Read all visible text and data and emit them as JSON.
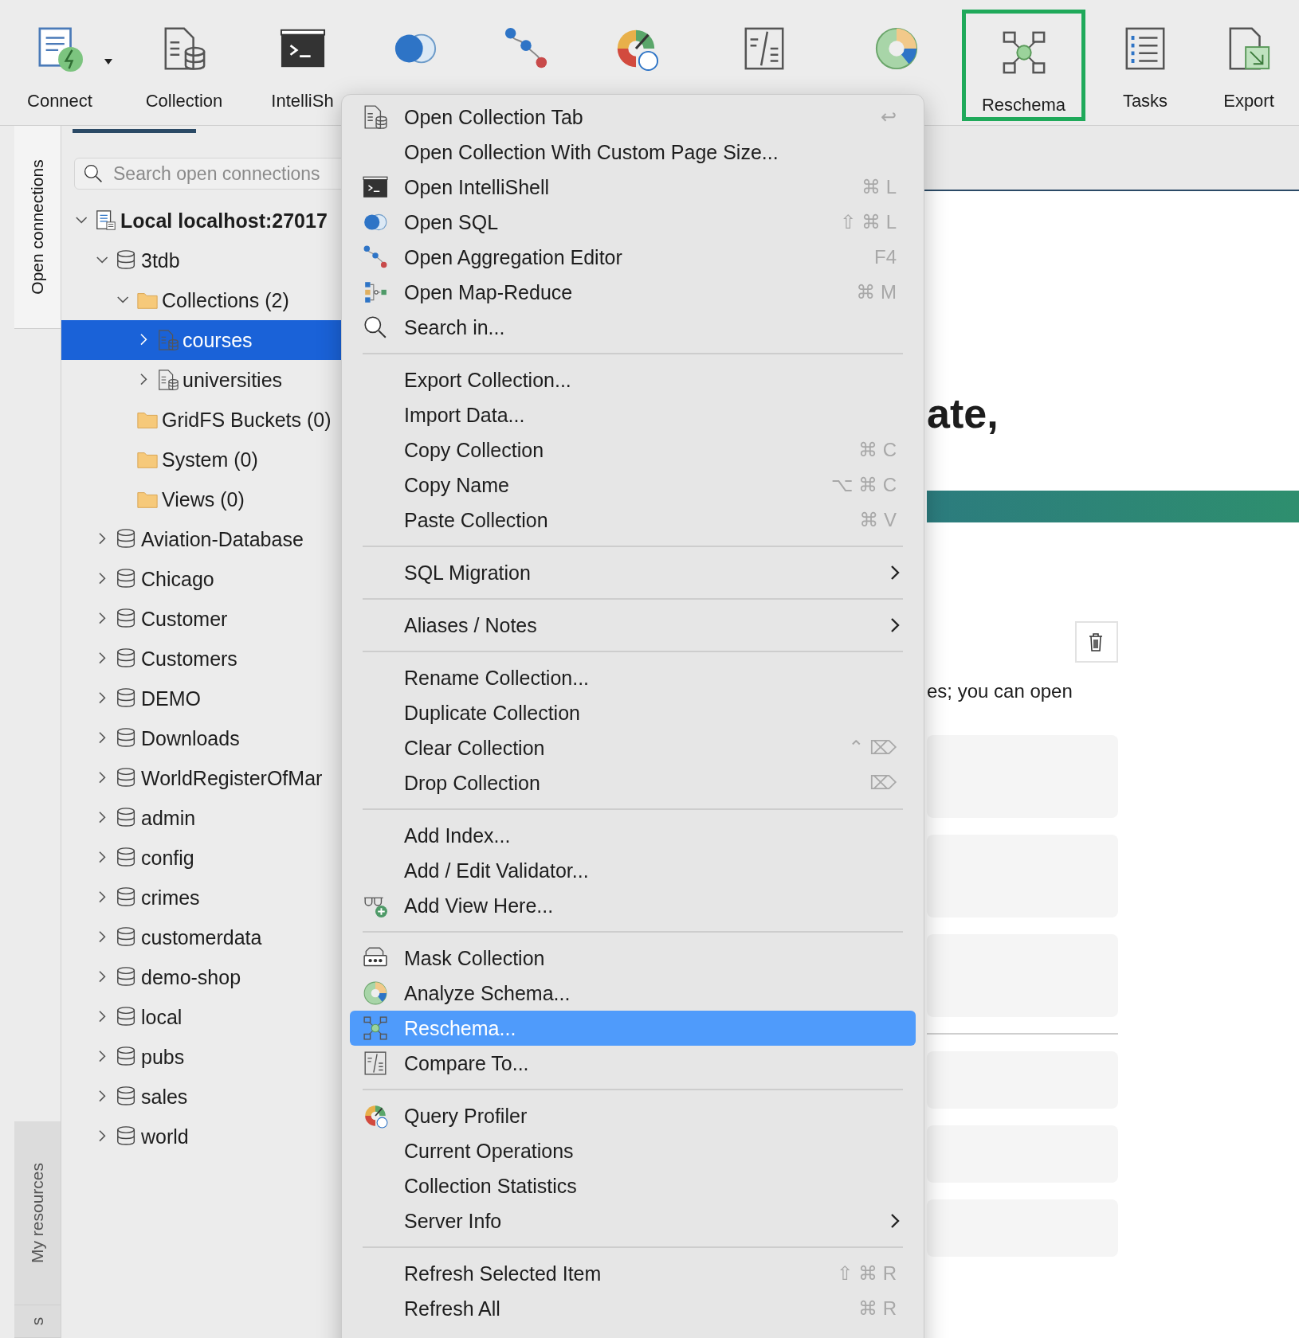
{
  "toolbar": [
    {
      "label": "Connect",
      "dropdown": true,
      "highlighted": false
    },
    {
      "label": "Collection",
      "highlighted": false
    },
    {
      "label": "IntelliSh",
      "highlighted": false
    },
    {
      "highlighted": false
    },
    {
      "highlighted": false
    },
    {
      "highlighted": false
    },
    {
      "highlighted": false
    },
    {
      "highlighted": false
    },
    {
      "label": "Reschema",
      "highlighted": true
    },
    {
      "label": "Tasks",
      "highlighted": false
    },
    {
      "label": "Export",
      "highlighted": false
    }
  ],
  "side_tabs": [
    {
      "label": "Open connections",
      "selected": true
    },
    {
      "label": "My resources",
      "selected": false
    },
    {
      "label": "s",
      "selected": false
    }
  ],
  "search": {
    "placeholder": "Search open connections"
  },
  "tree": [
    {
      "kind": "server",
      "label": "Local localhost:27017",
      "expanded": true,
      "selected": false,
      "children": [
        {
          "kind": "db",
          "label": "3tdb",
          "expanded": true,
          "selected": false,
          "children": [
            {
              "kind": "folder",
              "label": "Collections (2)",
              "expanded": true,
              "selected": false,
              "children": [
                {
                  "kind": "collection",
                  "label": "courses",
                  "expanded": false,
                  "selected": true
                },
                {
                  "kind": "collection",
                  "label": "universities",
                  "expanded": false,
                  "selected": false
                }
              ]
            },
            {
              "kind": "folder",
              "label": "GridFS Buckets (0)",
              "selected": false
            },
            {
              "kind": "folder",
              "label": "System (0)",
              "selected": false
            },
            {
              "kind": "folder",
              "label": "Views (0)",
              "selected": false
            }
          ]
        },
        {
          "kind": "db",
          "label": "Aviation-Database",
          "expanded": false,
          "selected": false
        },
        {
          "kind": "db",
          "label": "Chicago",
          "expanded": false,
          "selected": false
        },
        {
          "kind": "db",
          "label": "Customer",
          "expanded": false,
          "selected": false
        },
        {
          "kind": "db",
          "label": "Customers",
          "expanded": false,
          "selected": false
        },
        {
          "kind": "db",
          "label": "DEMO",
          "expanded": false,
          "selected": false
        },
        {
          "kind": "db",
          "label": "Downloads",
          "expanded": false,
          "selected": false
        },
        {
          "kind": "db",
          "label": "WorldRegisterOfMar",
          "expanded": false,
          "selected": false
        },
        {
          "kind": "db",
          "label": "admin",
          "expanded": false,
          "selected": false
        },
        {
          "kind": "db",
          "label": "config",
          "expanded": false,
          "selected": false
        },
        {
          "kind": "db",
          "label": "crimes",
          "expanded": false,
          "selected": false
        },
        {
          "kind": "db",
          "label": "customerdata",
          "expanded": false,
          "selected": false
        },
        {
          "kind": "db",
          "label": "demo-shop",
          "expanded": false,
          "selected": false
        },
        {
          "kind": "db",
          "label": "local",
          "expanded": false,
          "selected": false
        },
        {
          "kind": "db",
          "label": "pubs",
          "expanded": false,
          "selected": false
        },
        {
          "kind": "db",
          "label": "sales",
          "expanded": false,
          "selected": false
        },
        {
          "kind": "db",
          "label": "world",
          "expanded": false,
          "selected": false
        }
      ]
    }
  ],
  "main": {
    "heading": "ate,",
    "text": "es; you can open"
  },
  "context_menu": [
    {
      "kind": "item",
      "label": "Open Collection Tab",
      "shortcut": "↩",
      "submenu": false,
      "selected": false
    },
    {
      "kind": "item",
      "label": "Open Collection With Custom Page Size...",
      "submenu": false,
      "selected": false
    },
    {
      "kind": "item",
      "label": "Open IntelliShell",
      "shortcut": "⌘ L",
      "submenu": false,
      "selected": false
    },
    {
      "kind": "item",
      "label": "Open SQL",
      "shortcut": "⇧ ⌘ L",
      "submenu": false,
      "selected": false
    },
    {
      "kind": "item",
      "label": "Open Aggregation Editor",
      "shortcut": "F4",
      "submenu": false,
      "selected": false
    },
    {
      "kind": "item",
      "label": "Open Map-Reduce",
      "shortcut": "⌘ M",
      "submenu": false,
      "selected": false
    },
    {
      "kind": "item",
      "label": "Search in...",
      "submenu": false,
      "selected": false
    },
    {
      "kind": "separator"
    },
    {
      "kind": "item",
      "label": "Export Collection...",
      "submenu": false,
      "selected": false
    },
    {
      "kind": "item",
      "label": "Import Data...",
      "submenu": false,
      "selected": false
    },
    {
      "kind": "item",
      "label": "Copy Collection",
      "shortcut": "⌘ C",
      "submenu": false,
      "selected": false
    },
    {
      "kind": "item",
      "label": "Copy Name",
      "shortcut": "⌥ ⌘ C",
      "submenu": false,
      "selected": false
    },
    {
      "kind": "item",
      "label": "Paste Collection",
      "shortcut": "⌘ V",
      "submenu": false,
      "selected": false
    },
    {
      "kind": "separator"
    },
    {
      "kind": "item",
      "label": "SQL Migration",
      "submenu": true,
      "selected": false
    },
    {
      "kind": "separator"
    },
    {
      "kind": "item",
      "label": "Aliases / Notes",
      "submenu": true,
      "selected": false
    },
    {
      "kind": "separator"
    },
    {
      "kind": "item",
      "label": "Rename Collection...",
      "submenu": false,
      "selected": false
    },
    {
      "kind": "item",
      "label": "Duplicate Collection",
      "submenu": false,
      "selected": false
    },
    {
      "kind": "item",
      "label": "Clear Collection",
      "shortcut": "⌃ ⌦",
      "submenu": false,
      "selected": false
    },
    {
      "kind": "item",
      "label": "Drop Collection",
      "shortcut": "⌦",
      "submenu": false,
      "selected": false
    },
    {
      "kind": "separator"
    },
    {
      "kind": "item",
      "label": "Add Index...",
      "submenu": false,
      "selected": false
    },
    {
      "kind": "item",
      "label": "Add / Edit Validator...",
      "submenu": false,
      "selected": false
    },
    {
      "kind": "item",
      "label": "Add View Here...",
      "submenu": false,
      "selected": false
    },
    {
      "kind": "separator"
    },
    {
      "kind": "item",
      "label": "Mask Collection",
      "submenu": false,
      "selected": false
    },
    {
      "kind": "item",
      "label": "Analyze Schema...",
      "submenu": false,
      "selected": false
    },
    {
      "kind": "item",
      "label": "Reschema...",
      "submenu": false,
      "selected": true
    },
    {
      "kind": "item",
      "label": "Compare To...",
      "submenu": false,
      "selected": false
    },
    {
      "kind": "separator"
    },
    {
      "kind": "item",
      "label": "Query Profiler",
      "submenu": false,
      "selected": false
    },
    {
      "kind": "item",
      "label": "Current Operations",
      "submenu": false,
      "selected": false
    },
    {
      "kind": "item",
      "label": "Collection Statistics",
      "submenu": false,
      "selected": false
    },
    {
      "kind": "item",
      "label": "Server Info",
      "submenu": true,
      "selected": false
    },
    {
      "kind": "separator"
    },
    {
      "kind": "item",
      "label": "Refresh Selected Item",
      "shortcut": "⇧ ⌘ R",
      "submenu": false,
      "selected": false
    },
    {
      "kind": "item",
      "label": "Refresh All",
      "shortcut": "⌘ R",
      "submenu": false,
      "selected": false
    }
  ]
}
